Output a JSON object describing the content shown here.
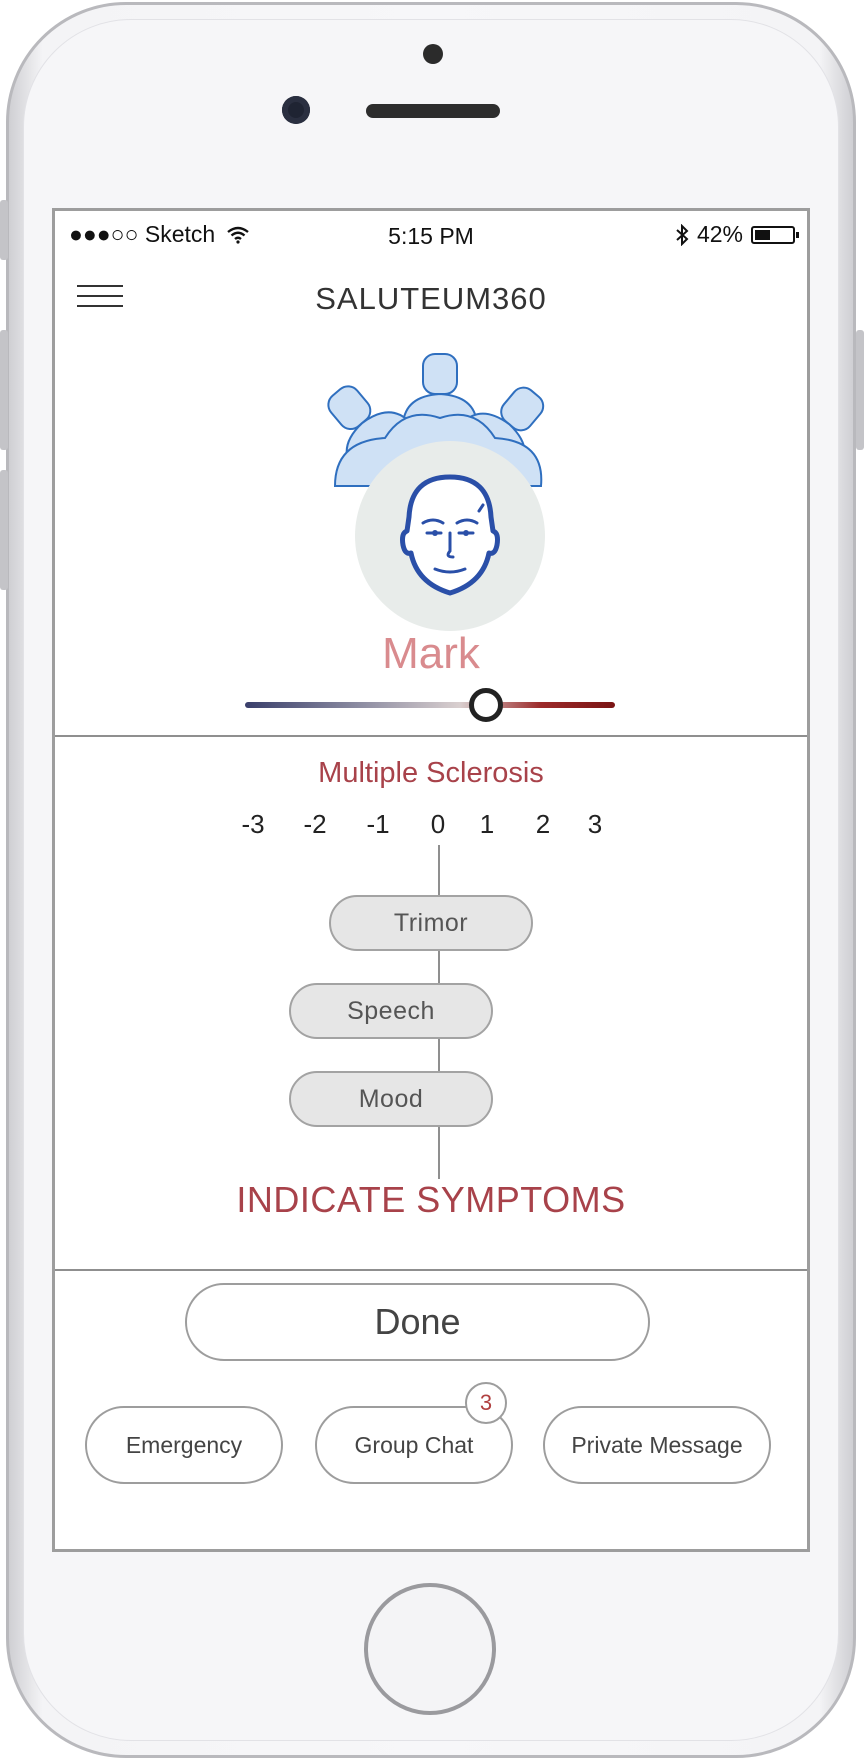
{
  "status_bar": {
    "carrier": "●●●○○ Sketch",
    "time": "5:15 PM",
    "battery_text": "42%",
    "battery_level": 0.42,
    "icons": [
      "wifi-icon",
      "bluetooth-icon",
      "battery-icon"
    ]
  },
  "header": {
    "title": "SALUTEUM360",
    "menu_icon": "hamburger-menu-icon"
  },
  "patient": {
    "name": "Mark",
    "avatar_icon": "patient-face-icon",
    "care_team_icon": "care-team-icon",
    "mood_slider_value": 0.65
  },
  "symptoms": {
    "condition": "Multiple Sclerosis",
    "scale": [
      "-3",
      "-2",
      "-1",
      "0",
      "1",
      "2",
      "3"
    ],
    "items": [
      {
        "label": "Trimor"
      },
      {
        "label": "Speech"
      },
      {
        "label": "Mood"
      }
    ],
    "prompt": "INDICATE SYMPTOMS"
  },
  "actions": {
    "done_label": "Done",
    "emergency_label": "Emergency",
    "group_chat_label": "Group Chat",
    "group_chat_badge": "3",
    "private_message_label": "Private Message"
  },
  "colors": {
    "accent": "#a8424a",
    "name_color": "#d98b8e",
    "slider_start": "#3a3f6b",
    "slider_end": "#7a1414",
    "avatar_stroke": "#2a4fa8",
    "team_fill": "#cfe1f5"
  }
}
